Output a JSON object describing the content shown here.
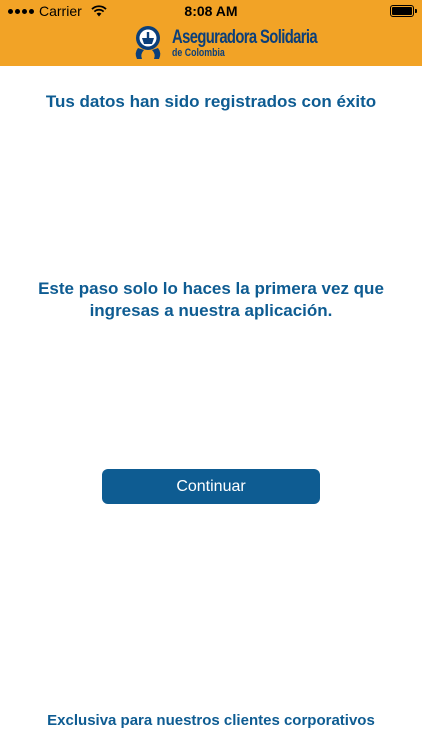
{
  "status_bar": {
    "carrier": "Carrier",
    "time": "8:08 AM",
    "icons": [
      "signal-icon",
      "wifi-icon",
      "battery-icon"
    ]
  },
  "header": {
    "brand_name": "Aseguradora Solidaria",
    "brand_sub": "de Colombia",
    "background_color": "#F2A326",
    "brand_color": "#0b3f7a"
  },
  "main": {
    "title": "Tus datos han sido registrados con éxito",
    "message": "Este paso solo lo haces la primera vez que ingresas a nuestra aplicación.",
    "continue_label": "Continuar",
    "accent_color": "#0E5C92"
  },
  "footer": {
    "text": "Exclusiva para nuestros clientes corporativos"
  }
}
